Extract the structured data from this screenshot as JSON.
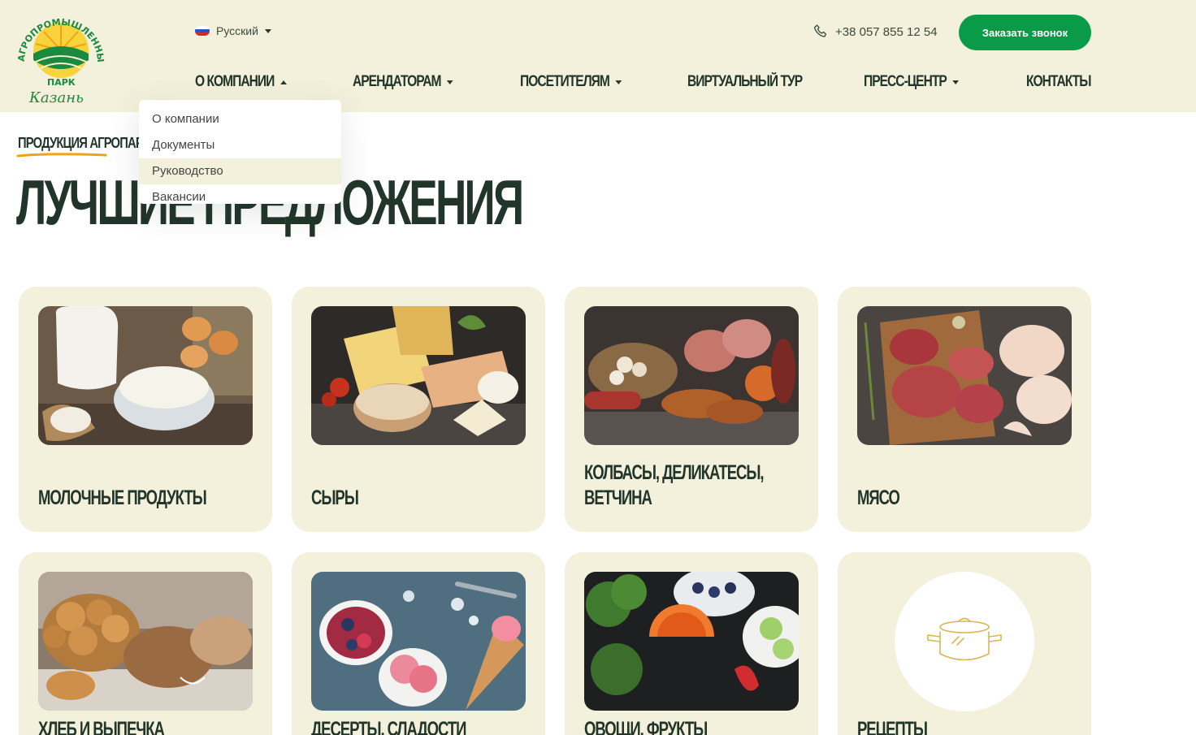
{
  "header": {
    "logo": {
      "arc_text": "АГРОПРОМЫШЛЕННЫЙ",
      "park": "ПАРК",
      "city": "Казань"
    },
    "language": "Русский",
    "phone": "+38 057 855 12 54",
    "call_button": "Заказать звонок"
  },
  "nav": {
    "items": [
      {
        "label": "О КОМПАНИИ",
        "has_caret": true
      },
      {
        "label": "АРЕНДАТОРАМ",
        "has_caret": true
      },
      {
        "label": "ПОСЕТИТЕЛЯМ",
        "has_caret": true
      },
      {
        "label": "ВИРТУАЛЬНЫЙ ТУР",
        "has_caret": false
      },
      {
        "label": "ПРЕСС-ЦЕНТР",
        "has_caret": true
      },
      {
        "label": "КОНТАКТЫ",
        "has_caret": false
      }
    ]
  },
  "dropdown": {
    "items": [
      "О компании",
      "Документы",
      "Руководство",
      "Вакансии"
    ],
    "highlighted": "Руководство"
  },
  "section": {
    "kicker": "ПРОДУКЦИЯ АГРОПАРКА",
    "title": "ЛУЧШИЕ ПРЕДЛОЖЕНИЯ"
  },
  "cards": [
    {
      "caption": "МОЛОЧНЫЕ ПРОДУКТЫ",
      "image": "dairy-photo"
    },
    {
      "caption": "СЫРЫ",
      "image": "cheese-photo"
    },
    {
      "caption": "КОЛБАСЫ, ДЕЛИКАТЕСЫ, ВЕТЧИНА",
      "image": "sausage-photo"
    },
    {
      "caption": "МЯСО",
      "image": "meat-photo"
    },
    {
      "caption": "ХЛЕБ И ВЫПЕЧКА",
      "image": "bread-photo"
    },
    {
      "caption": "ДЕСЕРТЫ, СЛАДОСТИ",
      "image": "dessert-photo"
    },
    {
      "caption": "ОВОЩИ, ФРУКТЫ",
      "image": "vegetables-photo"
    },
    {
      "caption": "РЕЦЕПТЫ",
      "image": "pot-icon"
    }
  ],
  "colors": {
    "header_bg": "#f3f1dc",
    "accent_green": "#0a9b49",
    "dark_green": "#22352a",
    "kicker_underline": "#f0a31a"
  }
}
